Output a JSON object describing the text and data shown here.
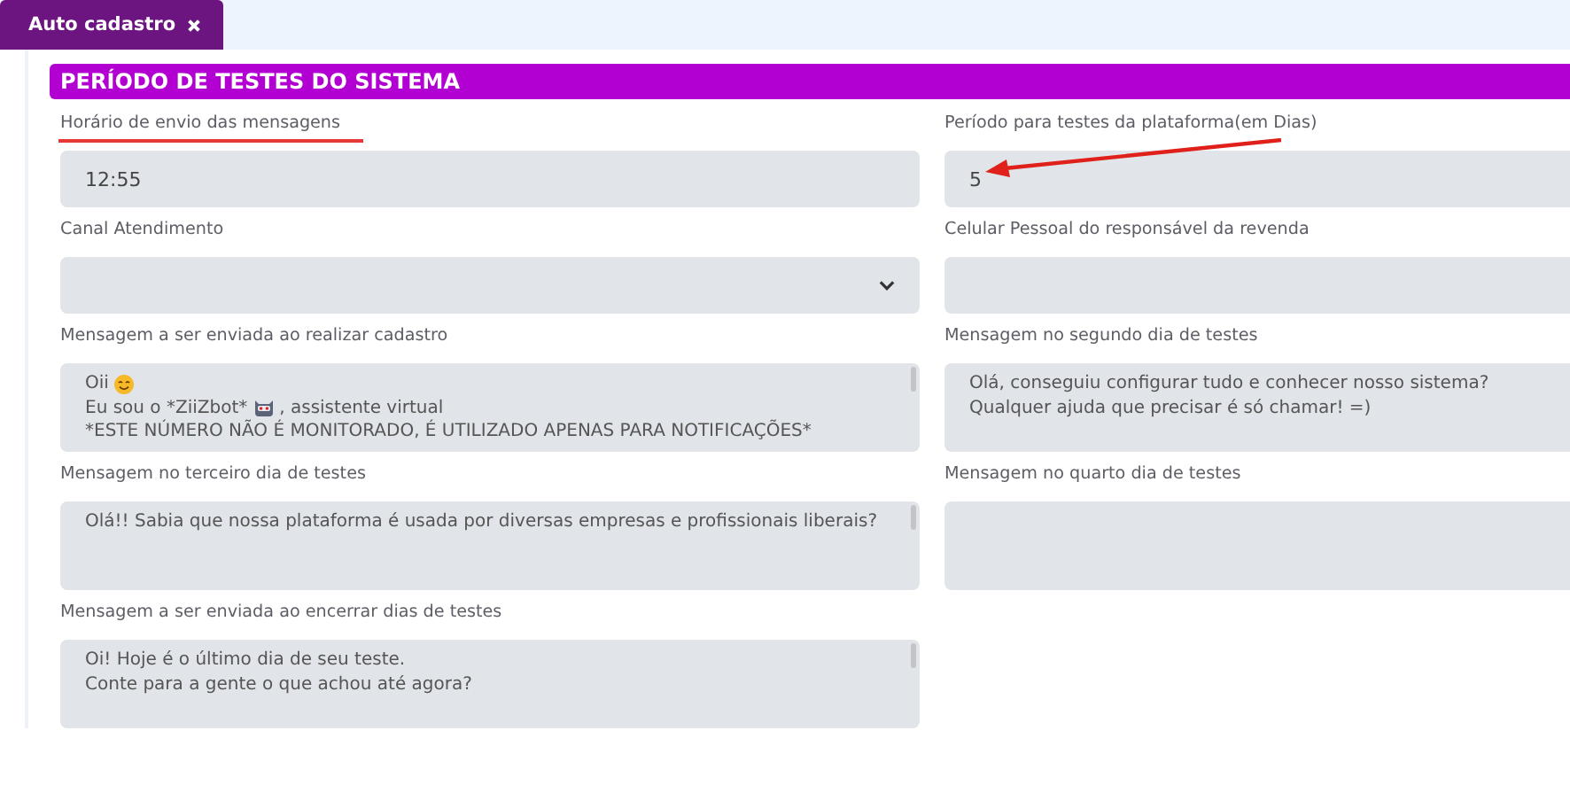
{
  "tabs": [
    {
      "label": "Auto cadastro",
      "selected": true
    }
  ],
  "section": {
    "title": "PERÍODO DE TESTES DO SISTEMA"
  },
  "fields": [
    {
      "kind": "input",
      "label": "Horário de envio das mensagens",
      "value": "12:55"
    },
    {
      "kind": "input",
      "label": "Período para testes da plataforma(em Dias)",
      "value": "5"
    },
    {
      "kind": "select",
      "label": "Canal Atendimento"
    },
    {
      "kind": "input",
      "label": "Celular Pessoal do responsável da revenda"
    },
    {
      "kind": "textarea",
      "label": "Mensagem a ser enviada ao realizar cadastro",
      "lines": [
        [
          {
            "kind": "text",
            "text": "Oii"
          },
          {
            "kind": "smiley"
          }
        ],
        [
          {
            "kind": "text",
            "text": "Eu sou o *ZiiZbot*"
          },
          {
            "kind": "robot"
          },
          {
            "kind": "text",
            "text": ", assistente virtual"
          }
        ],
        [
          {
            "kind": "text",
            "text": "*ESTE NÚMERO NÃO É MONITORADO, É UTILIZADO APENAS PARA NOTIFICAÇÕES*"
          }
        ]
      ]
    },
    {
      "kind": "textarea",
      "label": "Mensagem no segundo dia de testes",
      "lines": [
        [
          {
            "kind": "text",
            "text": "Olá, conseguiu configurar tudo e conhecer nosso sistema?"
          }
        ],
        [
          {
            "kind": "text",
            "text": "Qualquer ajuda que precisar é só chamar! =)"
          }
        ]
      ]
    },
    {
      "kind": "textarea",
      "label": "Mensagem no terceiro dia de testes",
      "lines": [
        [
          {
            "kind": "text",
            "text": "Olá!! Sabia que nossa plataforma é usada por diversas empresas e profissionais liberais?"
          }
        ]
      ]
    },
    {
      "kind": "textarea",
      "label": "Mensagem no quarto dia de testes"
    },
    {
      "kind": "textarea",
      "label": "Mensagem a ser enviada ao encerrar dias de testes",
      "lines": [
        [
          {
            "kind": "text",
            "text": "Oi! Hoje é o último dia de seu teste."
          }
        ],
        [
          {
            "kind": "text",
            "text": "Conte para a gente o que achou até agora?"
          }
        ]
      ]
    }
  ]
}
